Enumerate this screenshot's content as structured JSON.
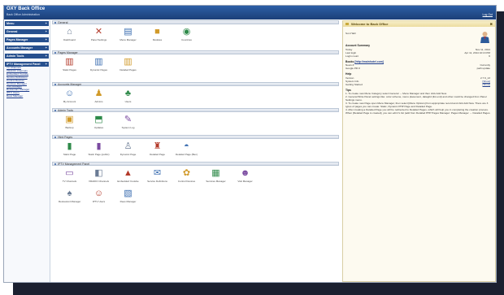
{
  "header": {
    "title": "OXY Back Office",
    "subtitle": "Back Office Administration",
    "logout": "Log Out"
  },
  "sidebar": {
    "sections": [
      {
        "label": "Menu",
        "items": []
      },
      {
        "label": "General",
        "items": []
      },
      {
        "label": "Pages Manager",
        "items": []
      },
      {
        "label": "Accounts Manager",
        "items": []
      },
      {
        "label": "Admin Tools",
        "items": []
      },
      {
        "label": "IPTV Management Panel",
        "items": [
          "TV Channels",
          "VRADIO Channels",
          "Embedded Youtube",
          "Service Definitions",
          "Control Devices",
          "Services Manager",
          "Visit Manager",
          "Restaurant Manager",
          "IPTV Users",
          "Rees Manager"
        ]
      }
    ]
  },
  "main": {
    "sections": [
      {
        "label": "General",
        "icons": [
          "Dashboard",
          "Panel Settings",
          "Menu Manager",
          "Modules",
          "Countries"
        ]
      },
      {
        "label": "Pages Manager",
        "icons": [
          "Static Pages",
          "Dynamic Pages",
          "Detailed Pages"
        ]
      },
      {
        "label": "Accounts Manager",
        "icons": [
          "My Account",
          "Admins",
          "Users"
        ]
      },
      {
        "label": "Admin Tools",
        "icons": [
          "Backup",
          "Updates",
          "System Log"
        ]
      },
      {
        "label": "Html Pages",
        "icons": [
          "Static Page",
          "Static Page (public)",
          "Dynamic Page",
          "Detailed Page",
          "Detailed Page (Ben)"
        ]
      },
      {
        "label": "IPTV Management Panel",
        "icons": [
          "TV Channels",
          "VRADIO Channels",
          "Embedded Youtube",
          "Service Definitions",
          "Control Devices",
          "Services Manager",
          "Visit Manager",
          "Restaurant Manager",
          "IPTV Users",
          "Rees Manager"
        ]
      }
    ]
  },
  "right": {
    "title": "Welcome to Back Office",
    "user": "Son Halil",
    "account_title": "Account Summary",
    "account_rows": [
      {
        "k": "Today",
        "v": "Nov 11, 2014"
      },
      {
        "k": "Last login",
        "v": "Apr 11, 2014 10:13 PM"
      },
      {
        "k": "Login count",
        "v": "6"
      }
    ],
    "books_title": "Books",
    "books_link": "[http://mainhotel.com]",
    "books_rows": [
      {
        "k": "News #",
        "v": "Currently"
      },
      {
        "k": "Google PR #",
        "v": "path update"
      }
    ],
    "help_title": "Help",
    "help_rows": [
      {
        "k": "Version",
        "v": "2.7.6_13"
      },
      {
        "k": "System Info",
        "v": "[Show]"
      },
      {
        "k": "Getting Started",
        "v": "[Show]"
      }
    ],
    "tips_title": "Tips",
    "tips": [
      "1. To create new Menu Category select General → Menu Manager and then click Add New.",
      "2. General Write Panel settings like: color scheme, menu placement, datagrid (list end) and other could be changed from Panel Settings menu.",
      "3. To create new Page open Menu Manager, then select [Menu Options] from appropriate record and click Add New. There are 3 types of pages you can create: Static, Dynamic PHP Page and Detailed Page.",
      "4. After creating a Detailed Page you will be redirected to Detailed Pages, which will help you in completing the creation process. When [Detailed Page is created], you can edit it's list (add from Detailed PHP Pages Manager: Pages Manager → Detailed Pages."
    ]
  },
  "colors": {
    "header": "#27508e",
    "accent": "#1d3c8c",
    "panel": "#fdfaf0"
  }
}
